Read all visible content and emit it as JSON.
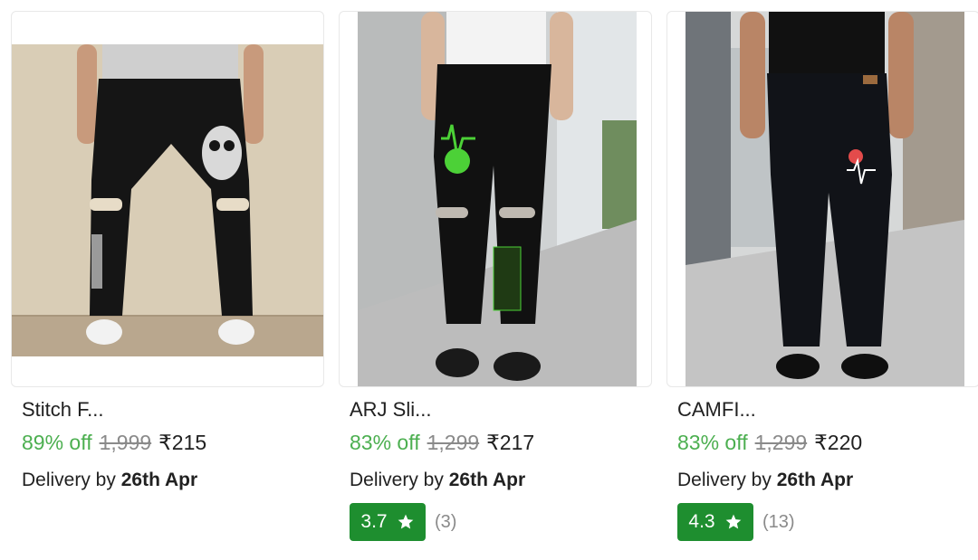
{
  "products": [
    {
      "title": "Stitch F...",
      "discount": "89% off",
      "mrp": "1,999",
      "price": "₹215",
      "delivery_prefix": "Delivery by",
      "delivery_date": "26th Apr",
      "rating": null,
      "rating_count": null
    },
    {
      "title": "ARJ Sli...",
      "discount": "83% off",
      "mrp": "1,299",
      "price": "₹217",
      "delivery_prefix": "Delivery by",
      "delivery_date": "26th Apr",
      "rating": "3.7",
      "rating_count": "(3)"
    },
    {
      "title": "CAMFI...",
      "discount": "83% off",
      "mrp": "1,299",
      "price": "₹220",
      "delivery_prefix": "Delivery by",
      "delivery_date": "26th Apr",
      "rating": "4.3",
      "rating_count": "(13)"
    }
  ],
  "colors": {
    "discount": "#4caf50",
    "rating_badge": "#1e8e2f",
    "mrp": "#8a8a8a"
  }
}
